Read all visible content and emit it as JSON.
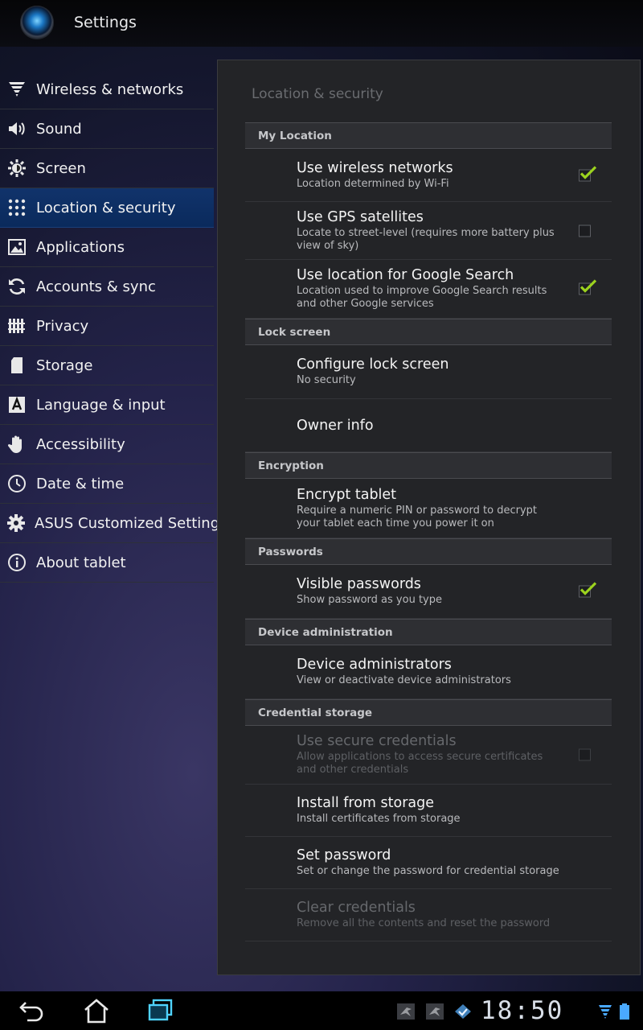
{
  "app": {
    "title": "Settings"
  },
  "sidebar": {
    "items": [
      {
        "label": "Wireless & networks",
        "icon": "wifi-icon"
      },
      {
        "label": "Sound",
        "icon": "speaker-icon"
      },
      {
        "label": "Screen",
        "icon": "brightness-icon"
      },
      {
        "label": "Location & security",
        "icon": "location-grid-icon",
        "active": true
      },
      {
        "label": "Applications",
        "icon": "applications-icon"
      },
      {
        "label": "Accounts & sync",
        "icon": "sync-icon"
      },
      {
        "label": "Privacy",
        "icon": "privacy-icon"
      },
      {
        "label": "Storage",
        "icon": "sdcard-icon"
      },
      {
        "label": "Language & input",
        "icon": "language-icon"
      },
      {
        "label": "Accessibility",
        "icon": "hand-icon"
      },
      {
        "label": "Date & time",
        "icon": "clock-icon"
      },
      {
        "label": "ASUS Customized Setting",
        "icon": "gear-icon"
      },
      {
        "label": "About tablet",
        "icon": "info-icon"
      }
    ]
  },
  "content": {
    "title": "Location & security",
    "sections": {
      "my_location": "My Location",
      "lock_screen": "Lock screen",
      "encryption": "Encryption",
      "passwords": "Passwords",
      "device_admin": "Device administration",
      "credential_storage": "Credential storage"
    },
    "items": {
      "wireless": {
        "title": "Use wireless networks",
        "summary": "Location determined by Wi-Fi",
        "checked": true
      },
      "gps": {
        "title": "Use GPS satellites",
        "summary": "Locate to street-level (requires more battery plus view of sky)",
        "checked": false
      },
      "google_search": {
        "title": "Use location for Google Search",
        "summary": "Location used to improve Google Search results and other Google services",
        "checked": true
      },
      "configure_lock": {
        "title": "Configure lock screen",
        "summary": "No security"
      },
      "owner_info": {
        "title": "Owner info"
      },
      "encrypt": {
        "title": "Encrypt tablet",
        "summary": "Require a numeric PIN or password to decrypt your tablet each time you power it on"
      },
      "visible_passwords": {
        "title": "Visible passwords",
        "summary": "Show password as you type",
        "checked": true
      },
      "device_admins": {
        "title": "Device administrators",
        "summary": "View or deactivate device administrators"
      },
      "secure_credentials": {
        "title": "Use secure credentials",
        "summary": "Allow applications to access secure certificates and other credentials",
        "checked": false,
        "disabled": true
      },
      "install_storage": {
        "title": "Install from storage",
        "summary": "Install certificates from storage"
      },
      "set_password": {
        "title": "Set password",
        "summary": "Set or change the password for credential storage"
      },
      "clear_credentials": {
        "title": "Clear credentials",
        "summary": "Remove all the contents and reset the password",
        "disabled": true
      }
    }
  },
  "statusbar": {
    "time": "18:50"
  },
  "colors": {
    "accent_check": "#9bd21e",
    "active_item": "#0e3167"
  }
}
